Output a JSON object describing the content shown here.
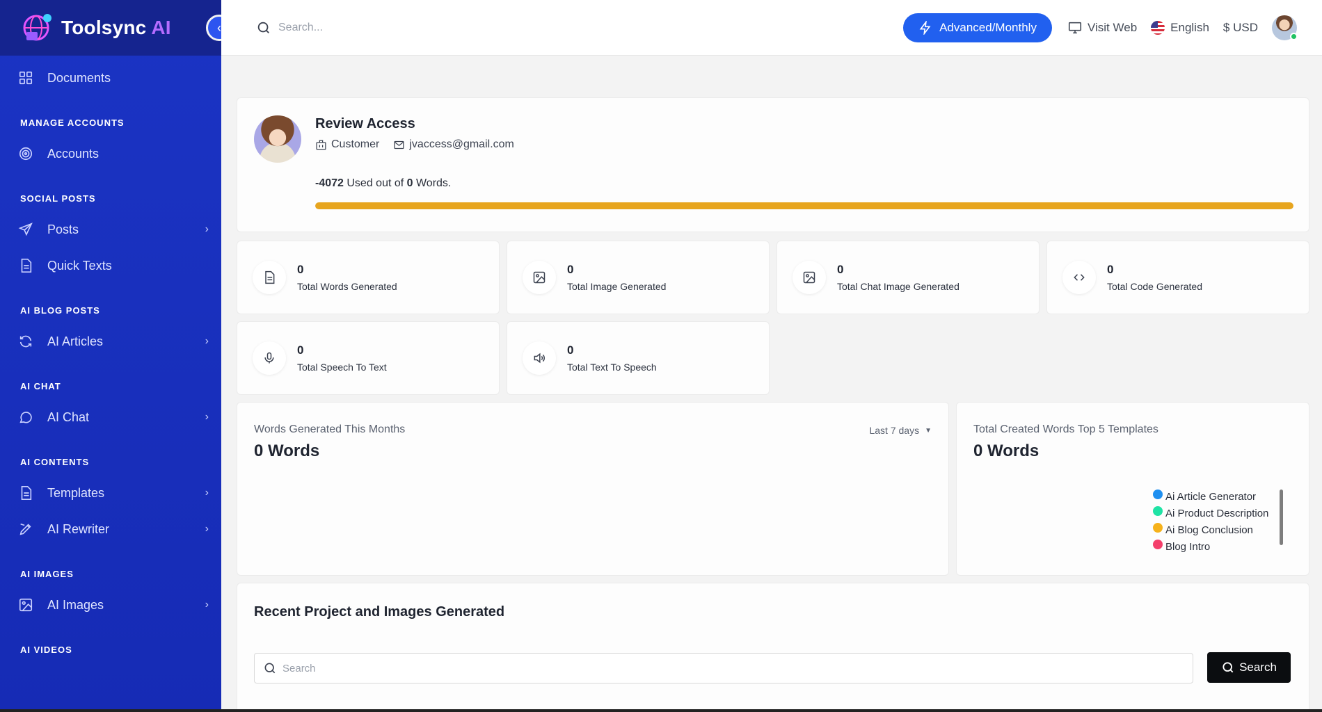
{
  "brand": {
    "name_main": "Toolsync",
    "name_accent": "AI"
  },
  "sidebar": {
    "sections": [
      {
        "title": "",
        "items": [
          {
            "label": "Documents",
            "icon": "grid-icon",
            "chevron": false
          }
        ]
      },
      {
        "title": "MANAGE ACCOUNTS",
        "items": [
          {
            "label": "Accounts",
            "icon": "target-icon",
            "chevron": false
          }
        ]
      },
      {
        "title": "SOCIAL POSTS",
        "items": [
          {
            "label": "Posts",
            "icon": "send-icon",
            "chevron": true
          },
          {
            "label": "Quick Texts",
            "icon": "document-icon",
            "chevron": false
          }
        ]
      },
      {
        "title": "AI BLOG POSTS",
        "items": [
          {
            "label": "AI Articles",
            "icon": "refresh-icon",
            "chevron": true
          }
        ]
      },
      {
        "title": "AI CHAT",
        "items": [
          {
            "label": "AI Chat",
            "icon": "chat-icon",
            "chevron": true
          }
        ]
      },
      {
        "title": "AI CONTENTS",
        "items": [
          {
            "label": "Templates",
            "icon": "document-icon",
            "chevron": true
          },
          {
            "label": "AI Rewriter",
            "icon": "pen-icon",
            "chevron": true
          }
        ]
      },
      {
        "title": "AI IMAGES",
        "items": [
          {
            "label": "AI Images",
            "icon": "image-icon",
            "chevron": true
          }
        ]
      },
      {
        "title": "AI VIDEOS",
        "items": []
      }
    ]
  },
  "topbar": {
    "search_placeholder": "Search...",
    "plan_label": "Advanced/Monthly",
    "visit_web": "Visit Web",
    "language": "English",
    "currency": "$ USD"
  },
  "profile": {
    "name": "Review Access",
    "role": "Customer",
    "email": "jvaccess@gmail.com",
    "usage_used": "-4072",
    "usage_mid": " Used out of ",
    "usage_total": "0",
    "usage_unit": " Words.",
    "usage_fraction": 1.0
  },
  "stats": [
    {
      "value": "0",
      "label": "Total Words Generated",
      "icon": "document-icon"
    },
    {
      "value": "0",
      "label": "Total Image Generated",
      "icon": "image-icon"
    },
    {
      "value": "0",
      "label": "Total Chat Image Generated",
      "icon": "image-icon"
    },
    {
      "value": "0",
      "label": "Total Code Generated",
      "icon": "code-icon"
    },
    {
      "value": "0",
      "label": "Total Speech To Text",
      "icon": "mic-icon"
    },
    {
      "value": "0",
      "label": "Total Text To Speech",
      "icon": "speaker-icon"
    }
  ],
  "words_month": {
    "title": "Words Generated This Months",
    "value": "0 Words",
    "range": "Last 7 days"
  },
  "top_templates": {
    "title": "Total Created Words Top 5 Templates",
    "value": "0 Words",
    "legend": [
      {
        "name": "Ai Article Generator",
        "color": "#1e8ff0"
      },
      {
        "name": "Ai Product Description",
        "color": "#1fe3a5"
      },
      {
        "name": "Ai Blog Conclusion",
        "color": "#f6b21b"
      },
      {
        "name": "Blog Intro",
        "color": "#f43f6b"
      }
    ]
  },
  "recent": {
    "title": "Recent Project and Images Generated",
    "search_placeholder": "Search",
    "search_button": "Search"
  }
}
